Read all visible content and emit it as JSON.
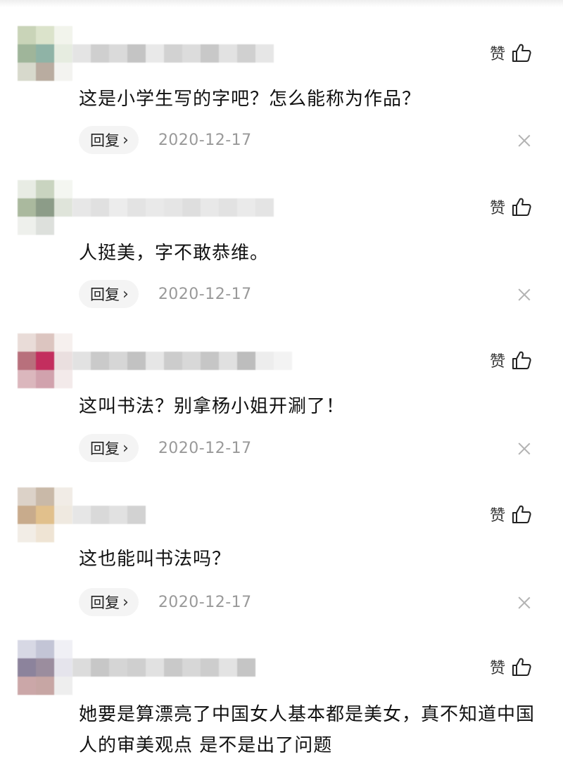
{
  "like_label": "赞",
  "reply_label": "回复",
  "reply_chevron": "›",
  "icons": {
    "like": "thumbs-up-icon",
    "dismiss": "close-icon",
    "reply_arrow": "chevron-right-icon"
  },
  "colors": {
    "date": "#999999",
    "reply_bg": "#f4f4f4",
    "close": "#b3b3b3"
  },
  "comments": [
    {
      "text": "这是小学生写的字吧？怎么能称为作品？",
      "date": "2020-12-17",
      "avatar_colors": [
        "#c9d4b8",
        "#dbe3cb",
        "#f2f4ec",
        "#9fb59a",
        "#8fb3a6",
        "#e6ece0",
        "#d7d9cc",
        "#b9aca0",
        "#f3f3f0"
      ],
      "username_colors": [
        "#e4e4e4",
        "#cfcfcf",
        "#dadada",
        "#c4c4c4",
        "#e9e9e9",
        "#d2d2d2",
        "#dcdcdc",
        "#c8c8c8",
        "#e2e2e2",
        "#d0d0d0",
        "#e6e6e6"
      ]
    },
    {
      "text": "人挺美，字不敢恭维。",
      "date": "2020-12-17",
      "avatar_colors": [
        "#e8ece4",
        "#c9d4c0",
        "#f4f6f1",
        "#aab99e",
        "#8c9c88",
        "#dfe4da",
        "#eef0ec",
        "#dde0dc",
        "#ffffff"
      ],
      "username_colors": [
        "#e7e7e7",
        "#e0e0e0",
        "#ececec",
        "#e3e3e3",
        "#e9e9e9",
        "#e5e5e5",
        "#dedede",
        "#e8e8e8",
        "#e2e2e2",
        "#eaeaea",
        "#e4e4e4"
      ]
    },
    {
      "text": "这叫书法？别拿杨小姐开涮了！",
      "date": "2020-12-17",
      "avatar_colors": [
        "#e9dcd8",
        "#dcc5c0",
        "#f6f0ee",
        "#b8707c",
        "#c32e5e",
        "#eadfdf",
        "#dbb7bd",
        "#d1a2ad",
        "#f3eaea"
      ],
      "username_colors": [
        "#e2e2e2",
        "#cacaca",
        "#d6d6d6",
        "#c2c2c2",
        "#e6e6e6",
        "#cccccc",
        "#d8d8d8",
        "#c6c6c6",
        "#e0e0e0",
        "#bdbdbd",
        "#ededed",
        "#f3f3f3"
      ]
    },
    {
      "text": "这也能叫书法吗？",
      "date": "2020-12-17",
      "avatar_colors": [
        "#dcd2c8",
        "#c9b9a8",
        "#f1ece6",
        "#c8ab8c",
        "#e1c08c",
        "#efe9e0",
        "#f2ede6",
        "#efe4d4",
        "#ffffff"
      ],
      "username_colors": [
        "#e6e6e6",
        "#d9d9d9",
        "#e1e1e1",
        "#d2d2d2"
      ]
    },
    {
      "text": "她要是算漂亮了中国女人基本都是美女，真不知道中国人的审美观点 是不是出了问题",
      "date": "",
      "avatar_colors": [
        "#d7d8e4",
        "#c3c5d6",
        "#f0f0f5",
        "#8c839c",
        "#9b8d9e",
        "#e5e4ec",
        "#cba7a8",
        "#c7a6a4",
        "#eeeeee"
      ],
      "username_colors": [
        "#dcdcdc",
        "#c7c7c7",
        "#d5d5d5",
        "#cfcfcf",
        "#e1e1e1",
        "#c9c9c9",
        "#d7d7d7",
        "#cdcdcd",
        "#e3e3e3",
        "#c5c5c5"
      ]
    }
  ]
}
